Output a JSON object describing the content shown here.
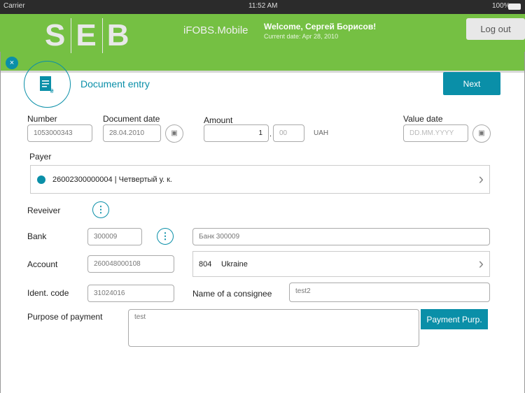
{
  "status": {
    "carrier": "Carrier",
    "time": "11:52 AM",
    "battery": "100%"
  },
  "header": {
    "logo": [
      "S",
      "E",
      "B"
    ],
    "app_name": "iFOBS.Mobile",
    "welcome": "Welcome, Сергей Борисов!",
    "current_date": "Current date: Apr 28, 2010",
    "logout": "Log out"
  },
  "page": {
    "title": "Document entry",
    "next": "Next",
    "close": "×"
  },
  "form": {
    "number_label": "Number",
    "number": "1053000343",
    "doc_date_label": "Document date",
    "doc_date": "28.04.2010",
    "amount_label": "Amount",
    "amount_int": "1",
    "amount_sep": ".",
    "amount_dec": "00",
    "currency": "UAH",
    "value_date_label": "Value date",
    "value_date_placeholder": "DD.MM.YYYY",
    "payer_label": "Payer",
    "payer": "26002300000004 | Четвертый у. к.",
    "receiver_label": "Reveiver",
    "bank_label": "Bank",
    "bank_code": "300009",
    "bank_name": "Банк 300009",
    "account_label": "Account",
    "account": "260048000108",
    "country_code": "804",
    "country": "Ukraine",
    "ident_label": "Ident. code",
    "ident": "31024016",
    "consignee_label": "Name of a consignee",
    "consignee": "test2",
    "purpose_label": "Purpose of payment",
    "purpose": "test",
    "purpose_button": "Payment Purp."
  }
}
